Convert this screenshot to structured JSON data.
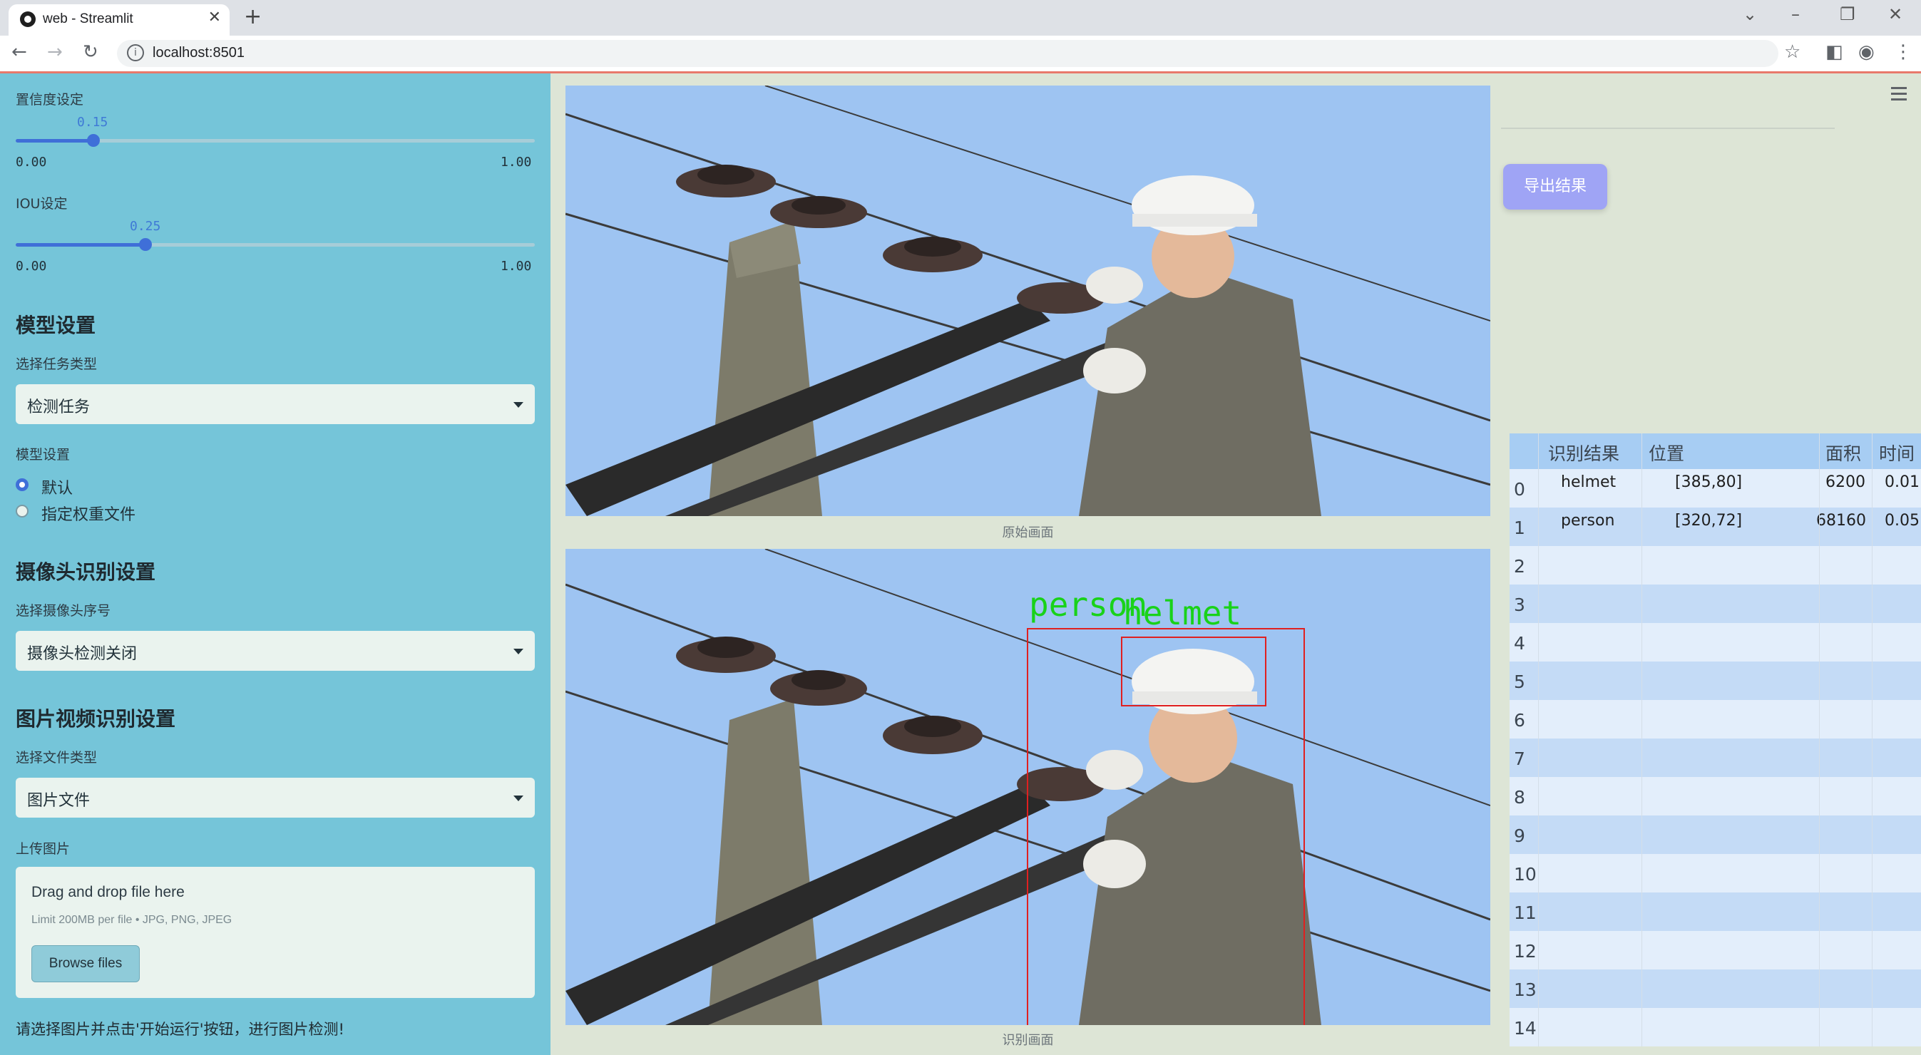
{
  "browser": {
    "tab_title": "web - Streamlit",
    "url": "localhost:8501"
  },
  "sidebar": {
    "confidence": {
      "label": "置信度设定",
      "value": 0.15,
      "value_text": "0.15",
      "min": "0.00",
      "max": "1.00"
    },
    "iou": {
      "label": "IOU设定",
      "value": 0.25,
      "value_text": "0.25",
      "min": "0.00",
      "max": "1.00"
    },
    "model_section": {
      "heading": "模型设置",
      "task_label": "选择任务类型",
      "task_value": "检测任务",
      "model_label": "模型设置",
      "options": [
        "默认",
        "指定权重文件"
      ],
      "selected_option": "默认"
    },
    "camera_section": {
      "heading": "摄像头识别设置",
      "camera_label": "选择摄像头序号",
      "camera_value": "摄像头检测关闭"
    },
    "file_section": {
      "heading": "图片视频识别设置",
      "type_label": "选择文件类型",
      "type_value": "图片文件",
      "upload_label": "上传图片",
      "drop_text": "Drag and drop file here",
      "limit_text": "Limit 200MB per file • JPG, PNG, JPEG",
      "browse_label": "Browse files"
    },
    "hint": "请选择图片并点击'开始运行'按钮，进行图片检测!"
  },
  "main": {
    "original_caption": "原始画面",
    "result_caption": "识别画面",
    "detections_overlay": [
      {
        "label": "person",
        "color": "#19d219"
      },
      {
        "label": "helmet",
        "color": "#19d219"
      }
    ],
    "box_color": "#e02020",
    "export_label": "导出结果"
  },
  "results_table": {
    "headers": [
      "识别结果",
      "位置",
      "面积",
      "时间"
    ],
    "rows": [
      {
        "index": "0",
        "label": "helmet",
        "position": "[385,80]",
        "area": "6200",
        "time": "0.01"
      },
      {
        "index": "1",
        "label": "person",
        "position": "[320,72]",
        "area": "68160",
        "time": "0.05"
      }
    ],
    "empty_indices": [
      "2",
      "3",
      "4",
      "5",
      "6",
      "7",
      "8",
      "9",
      "10",
      "11",
      "12",
      "13",
      "14"
    ]
  },
  "colors": {
    "sidebar_bg": "#75c5d9",
    "accent": "#3f6fd8",
    "export_button": "#9fa4f5",
    "table_header": "#a7cdf3"
  }
}
